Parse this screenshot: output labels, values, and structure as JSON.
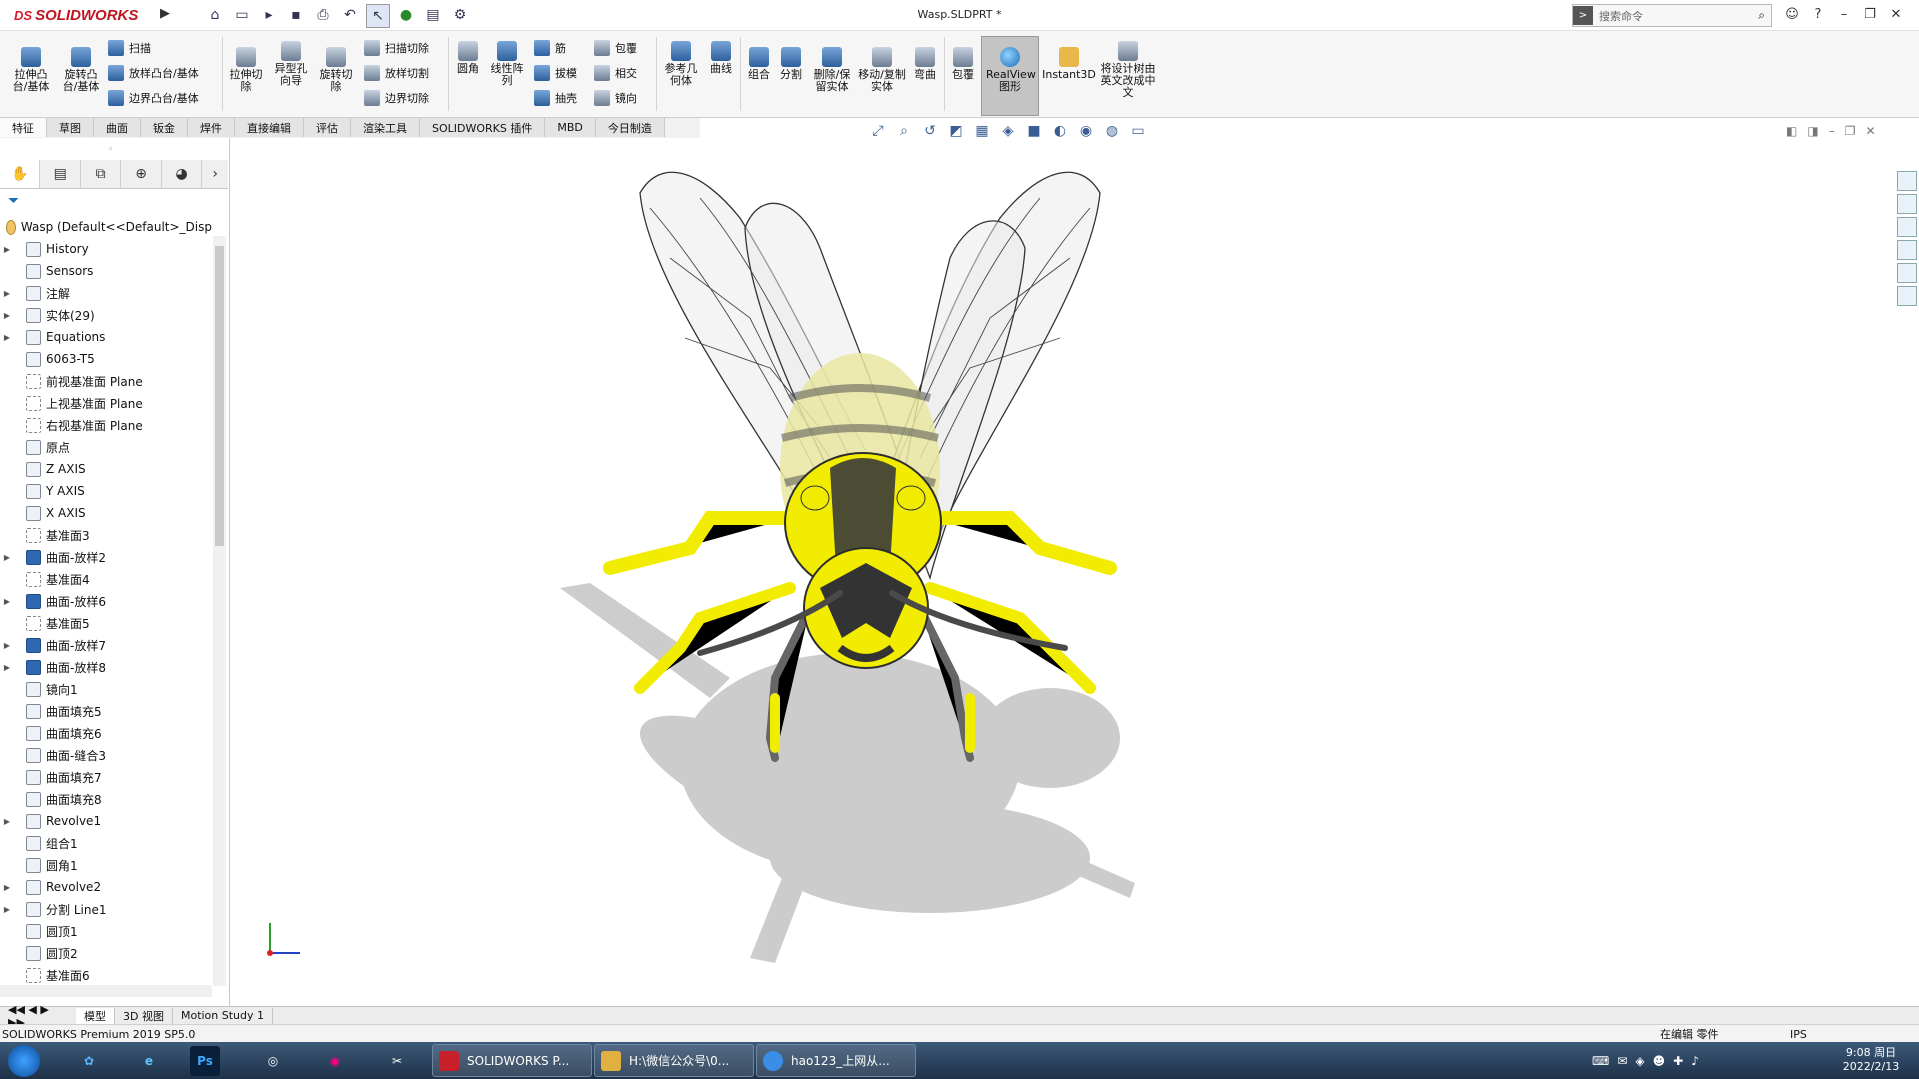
{
  "app": {
    "logo_text": "SOLIDWORKS",
    "logo_prefix": "DS",
    "title": "Wasp.SLDPRT *",
    "search_placeholder": "搜索命令"
  },
  "ribbon": {
    "buttons": [
      {
        "label": "拉伸凸台/基体"
      },
      {
        "label": "旋转凸台/基体"
      },
      {
        "label": "拉伸切除"
      },
      {
        "label": "异型孔向导"
      },
      {
        "label": "旋转切除"
      },
      {
        "label": "圆角"
      },
      {
        "label": "线性阵列"
      },
      {
        "label": "参考几何体"
      },
      {
        "label": "曲线"
      },
      {
        "label": "组合"
      },
      {
        "label": "分割"
      },
      {
        "label": "删除/保留实体"
      },
      {
        "label": "移动/复制实体"
      },
      {
        "label": "弯曲"
      },
      {
        "label": "包覆"
      },
      {
        "label": "RealView 图形"
      },
      {
        "label": "Instant3D"
      },
      {
        "label": "将设计树由英文改成中文"
      }
    ],
    "small": [
      {
        "label": "扫描"
      },
      {
        "label": "放样凸台/基体"
      },
      {
        "label": "边界凸台/基体"
      },
      {
        "label": "扫描切除"
      },
      {
        "label": "放样切割"
      },
      {
        "label": "边界切除"
      },
      {
        "label": "筋"
      },
      {
        "label": "拔模"
      },
      {
        "label": "抽壳"
      },
      {
        "label": "包覆"
      },
      {
        "label": "相交"
      },
      {
        "label": "镜向"
      }
    ]
  },
  "tabs": [
    "特征",
    "草图",
    "曲面",
    "钣金",
    "焊件",
    "直接编辑",
    "评估",
    "渲染工具",
    "SOLIDWORKS 插件",
    "MBD",
    "今日制造"
  ],
  "tree": {
    "root": "Wasp  (Default<<Default>_Disp",
    "items": [
      {
        "label": "History",
        "exp": true
      },
      {
        "label": "Sensors",
        "exp": false
      },
      {
        "label": "注解",
        "exp": true
      },
      {
        "label": "实体(29)",
        "exp": true
      },
      {
        "label": "Equations",
        "exp": true
      },
      {
        "label": "6063-T5",
        "exp": false
      },
      {
        "label": "前视基准面 Plane",
        "exp": false
      },
      {
        "label": "上视基准面 Plane",
        "exp": false
      },
      {
        "label": "右视基准面 Plane",
        "exp": false
      },
      {
        "label": "原点",
        "exp": false
      },
      {
        "label": "Z AXIS",
        "exp": false
      },
      {
        "label": "Y AXIS",
        "exp": false
      },
      {
        "label": "X AXIS",
        "exp": false
      },
      {
        "label": "基准面3",
        "exp": false
      },
      {
        "label": "曲面-放样2",
        "exp": true
      },
      {
        "label": "基准面4",
        "exp": false
      },
      {
        "label": "曲面-放样6",
        "exp": true
      },
      {
        "label": "基准面5",
        "exp": false
      },
      {
        "label": "曲面-放样7",
        "exp": true
      },
      {
        "label": "曲面-放样8",
        "exp": true
      },
      {
        "label": "镜向1",
        "exp": false
      },
      {
        "label": "曲面填充5",
        "exp": false
      },
      {
        "label": "曲面填充6",
        "exp": false
      },
      {
        "label": "曲面-缝合3",
        "exp": false
      },
      {
        "label": "曲面填充7",
        "exp": false
      },
      {
        "label": "曲面填充8",
        "exp": false
      },
      {
        "label": "Revolve1",
        "exp": true
      },
      {
        "label": "组合1",
        "exp": false
      },
      {
        "label": "圆角1",
        "exp": false
      },
      {
        "label": "Revolve2",
        "exp": true
      },
      {
        "label": "分割 Line1",
        "exp": true
      },
      {
        "label": "圆顶1",
        "exp": false
      },
      {
        "label": "圆顶2",
        "exp": false
      },
      {
        "label": "基准面6",
        "exp": false
      }
    ]
  },
  "bottom_tabs": [
    "模型",
    "3D 视图",
    "Motion Study 1"
  ],
  "status": {
    "left": "SOLIDWORKS Premium 2019 SP5.0",
    "mode": "在编辑 零件",
    "units": "IPS"
  },
  "taskbar": {
    "windows": [
      {
        "label": "SOLIDWORKS P...",
        "color": "#c8202a"
      },
      {
        "label": "H:\\微信公众号\\0...",
        "color": "#e0b040"
      },
      {
        "label": "hao123_上网从...",
        "color": "#3a8ee6"
      }
    ],
    "time": "9:08 周日",
    "date": "2022/2/13"
  },
  "colors": {
    "accent": "#d41f2b",
    "wasp_yellow": "#f5f000",
    "wasp_dark": "#3c3c3c"
  }
}
